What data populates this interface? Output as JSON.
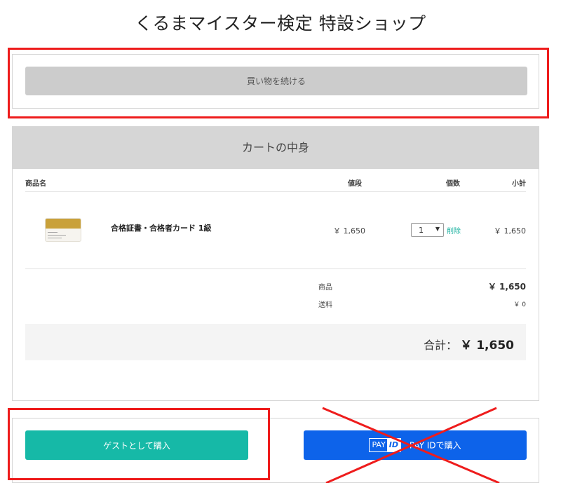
{
  "page": {
    "title": "くるまマイスター検定 特設ショップ"
  },
  "nav": {
    "continue_label": "買い物を続ける"
  },
  "cart": {
    "heading": "カートの中身",
    "columns": {
      "name": "商品名",
      "price": "値段",
      "qty": "個数",
      "subtotal": "小計"
    },
    "items": [
      {
        "thumbnail_icon": "certificate-card-thumbnail",
        "name": "合格証書・合格者カード 1級",
        "price": "￥ 1,650",
        "qty": "1",
        "delete_label": "削除",
        "subtotal": "￥ 1,650"
      }
    ],
    "summary": {
      "goods_label": "商品",
      "goods_value": "￥ 1,650",
      "shipping_label": "送料",
      "shipping_value": "￥ 0"
    },
    "total": {
      "label": "合計：",
      "value": "￥ 1,650"
    }
  },
  "purchase": {
    "guest_label": "ゲストとして購入",
    "payid_label": "PAY IDで購入",
    "payid_logo_pay": "PAY",
    "payid_logo_id": "ID"
  },
  "colors": {
    "accent": "#16b9a7",
    "payid_blue": "#0d63ea",
    "annotation_red": "#ee1c1c",
    "continue_button": "#cccccc",
    "header_gray": "#d6d6d6"
  }
}
